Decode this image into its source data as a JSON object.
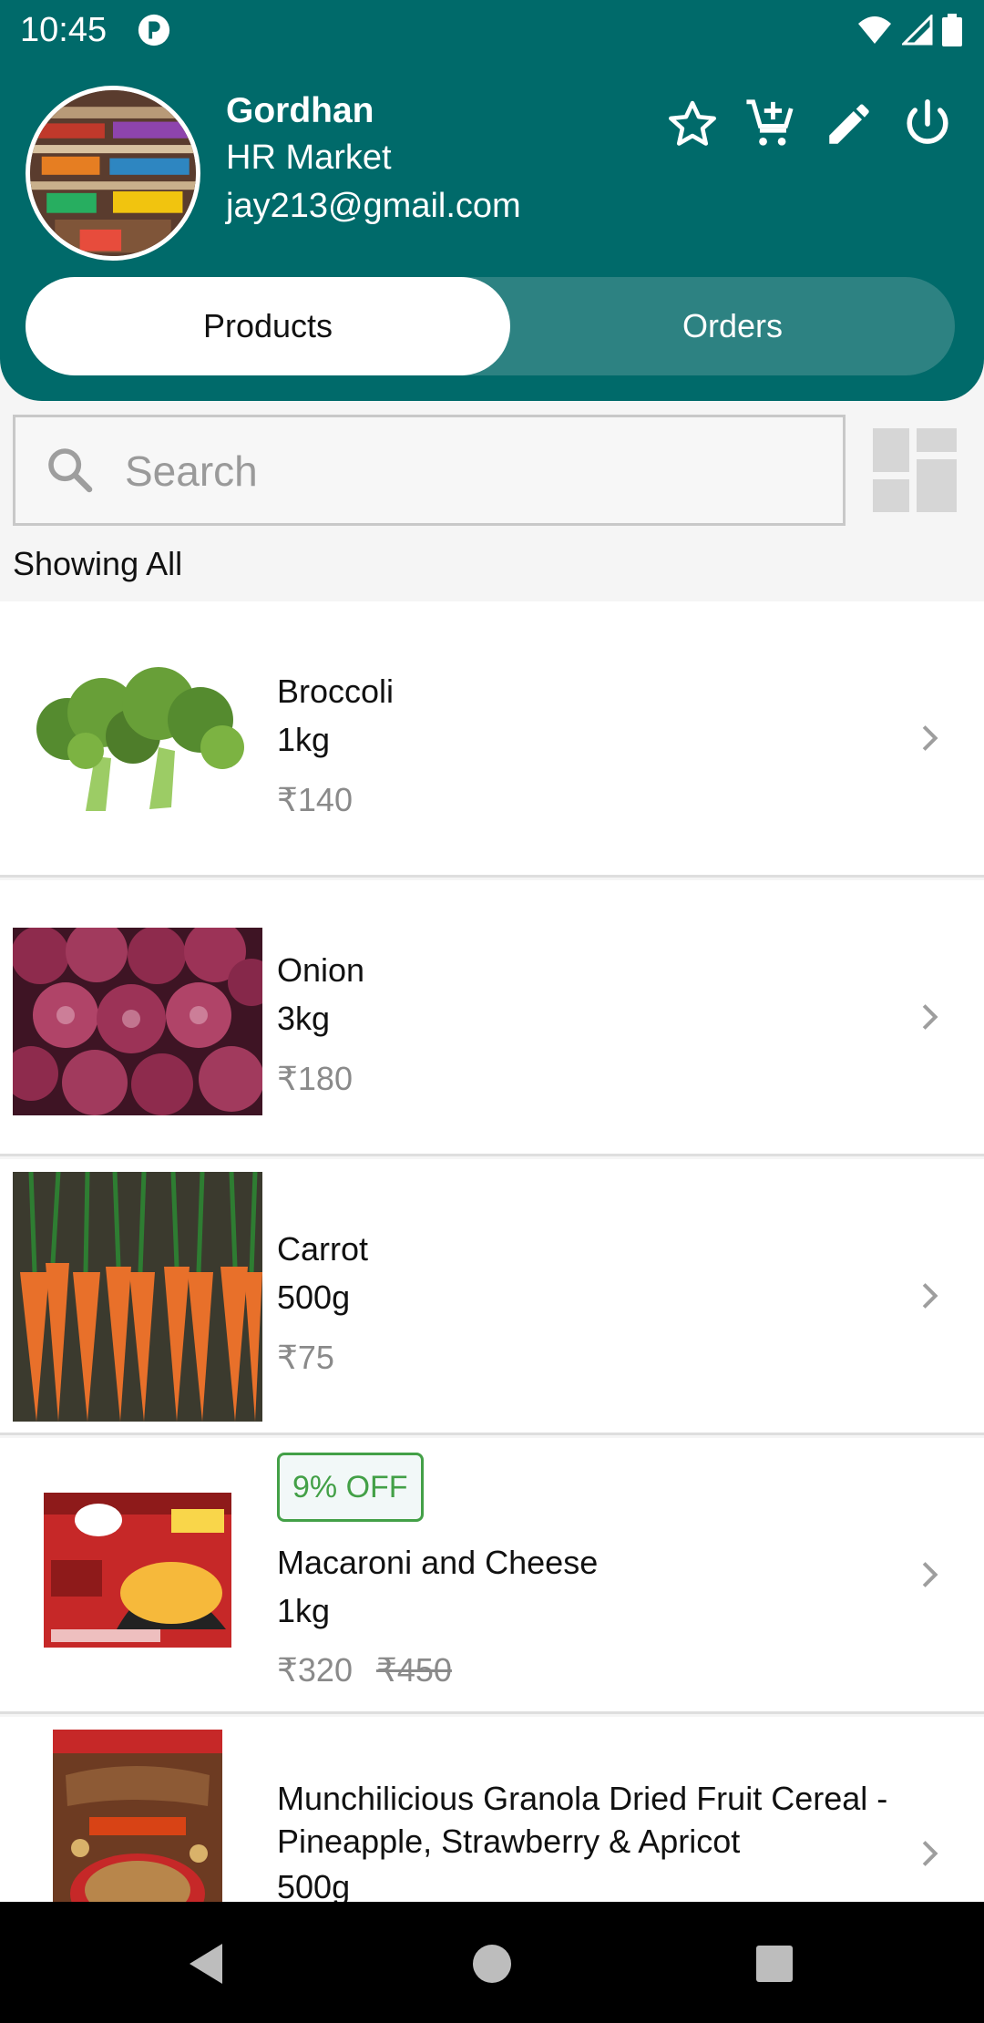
{
  "status_bar": {
    "time": "10:45"
  },
  "profile": {
    "name": "Gordhan",
    "shop": "HR Market",
    "email": "jay213@gmail.com"
  },
  "header_actions": [
    "star-icon",
    "add-to-cart-icon",
    "edit-icon",
    "power-icon"
  ],
  "tabs": {
    "products": "Products",
    "orders": "Orders",
    "active": "Products"
  },
  "search": {
    "placeholder": "Search",
    "value": ""
  },
  "filter_label": "Showing All",
  "products": [
    {
      "name": "Broccoli",
      "quantity": "1kg",
      "price": "₹140"
    },
    {
      "name": "Onion",
      "quantity": "3kg",
      "price": "₹180"
    },
    {
      "name": "Carrot",
      "quantity": "500g",
      "price": "₹75"
    },
    {
      "name": "Macaroni and Cheese",
      "quantity": "1kg",
      "price": "₹320",
      "old_price": "₹450",
      "badge": "9% OFF"
    },
    {
      "name": "Munchilicious Granola Dried Fruit Cereal - Pineapple, Strawberry & Apricot",
      "quantity": "500g"
    }
  ],
  "colors": {
    "header": "#006a6a",
    "tab_track": "#2d8282",
    "offer_green": "#43a047",
    "price_gray": "#8a8a8a"
  }
}
